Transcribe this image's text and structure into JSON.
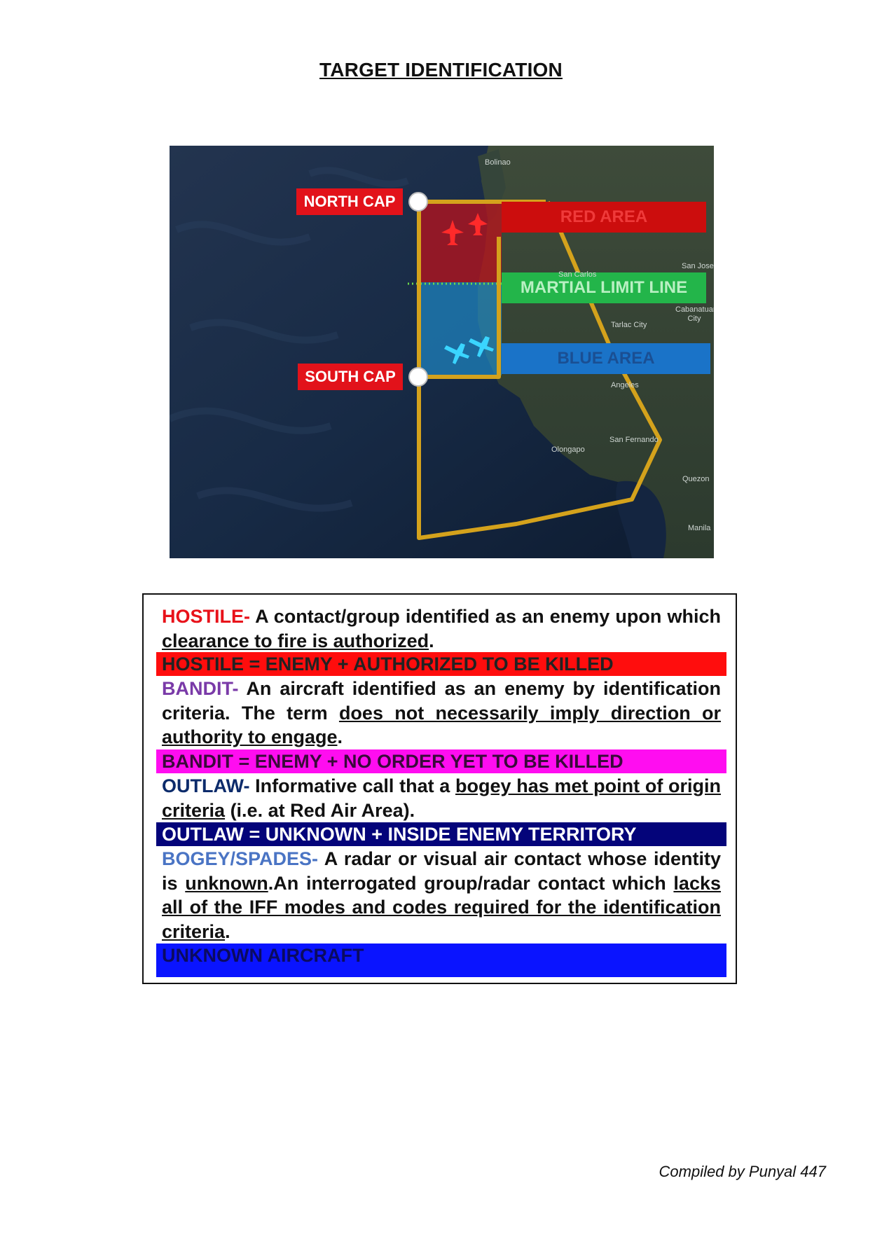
{
  "title": "TARGET IDENTIFICATION",
  "colors": {
    "hostile": "#e8121a",
    "bandit": "#7a3aa8",
    "outlaw": "#0c2b6b",
    "bogey": "#4a74c4",
    "band_hostile": "#ff0d0d",
    "band_bandit": "#ff0df0",
    "band_outlaw": "#04047a",
    "band_unknown": "#0a14ff",
    "zone_line": "#d4a21c",
    "red_area_label": "#cc0d0d",
    "martial_label": "#23b54a",
    "blue_area_label": "#1a73c8"
  },
  "map": {
    "north_cap": "NORTH CAP",
    "south_cap": "SOUTH CAP",
    "red_area": "RED AREA",
    "martial_limit_line": "MARTIAL LIMIT LINE",
    "blue_area": "BLUE AREA",
    "towns": [
      "Bolinao",
      "San Carlos",
      "San Jose",
      "Tarlac City",
      "Cabanatuan City",
      "Angeles",
      "San Fernando",
      "Olongapo",
      "Quezon",
      "Manila"
    ]
  },
  "definitions": {
    "hostile": {
      "term": "HOSTILE-",
      "text1": " A contact/group identified as an enemy upon which ",
      "underline1": "clearance to fire is authorized",
      "text2": ".",
      "band": "HOSTILE = ENEMY + AUTHORIZED TO BE KILLED"
    },
    "bandit": {
      "term": "BANDIT-",
      "text1": " An aircraft identified as an enemy by identification criteria. The term ",
      "underline1": "does not necessarily imply direction or authority to engage",
      "text2": ".",
      "band": "BANDIT = ENEMY + NO ORDER YET TO BE KILLED"
    },
    "outlaw": {
      "term": "OUTLAW-",
      "text1": " Informative call that a ",
      "underline1": "bogey has met point of origin criteria",
      "text2": " (i.e. at Red Air Area).",
      "band": "OUTLAW = UNKNOWN + INSIDE ENEMY TERRITORY"
    },
    "bogey": {
      "term": "BOGEY/SPADES-",
      "text1": " A radar or visual air contact whose identity is ",
      "underline1": "unknown",
      "text2": ".An interrogated group/radar contact which ",
      "underline2": "lacks all of the IFF modes and codes required for the identification criteria",
      "text3": ".",
      "band": "UNKNOWN AIRCRAFT"
    }
  },
  "footer": "Compiled by Punyal 447"
}
